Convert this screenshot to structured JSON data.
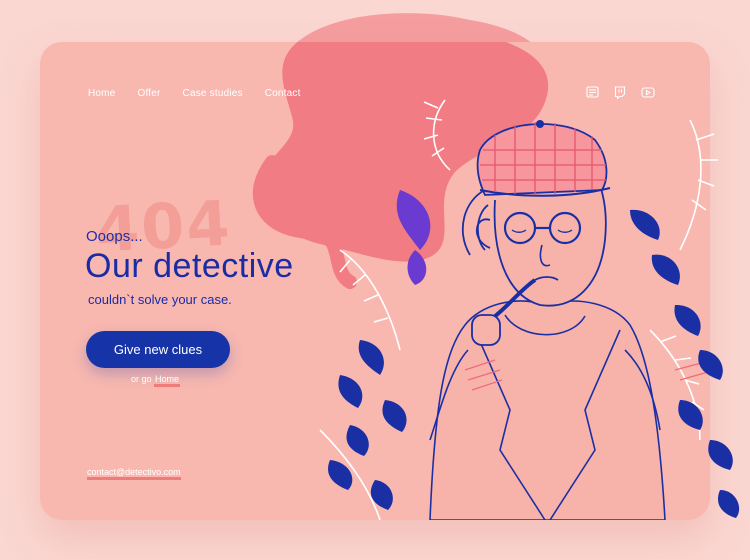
{
  "nav": {
    "items": [
      "Home",
      "Offer",
      "Case studies",
      "Contact"
    ]
  },
  "social": {
    "icons": [
      "news-icon",
      "twitch-icon",
      "youtube-icon"
    ]
  },
  "error": {
    "code": "404",
    "oops": "Ooops...",
    "headline": "Our detective",
    "sub": "couldn`t solve your case."
  },
  "cta": {
    "label": "Give new clues"
  },
  "secondary": {
    "prefix": "or go",
    "home": "Home"
  },
  "footer": {
    "email": "contact@detectivo.com"
  },
  "colors": {
    "page_bg": "#fbd7d2",
    "card_bg": "#f8b8b0",
    "blob": "#f2868a",
    "primary_blue": "#1733a8",
    "underline": "#ef7b7a"
  }
}
